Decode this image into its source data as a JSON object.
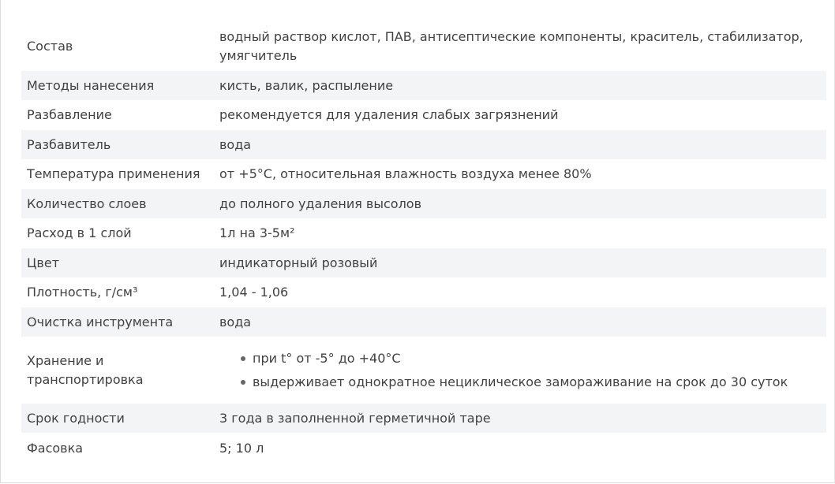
{
  "rows": [
    {
      "label": "Состав",
      "value": "водный раствор кислот, ПАВ, антисептические компоненты, краситель, стабилизатор, умягчитель"
    },
    {
      "label": "Методы нанесения",
      "value": "кисть, валик, распыление"
    },
    {
      "label": "Разбавление",
      "value": "рекомендуется для удаления слабых загрязнений"
    },
    {
      "label": "Разбавитель",
      "value": "вода"
    },
    {
      "label": "Температура применения",
      "value": "от +5°С, относительная влажность воздуха менее 80%"
    },
    {
      "label": "Количество слоев",
      "value": "до полного удаления высолов"
    },
    {
      "label": "Расход в 1 слой",
      "value": "1л на 3-5м²"
    },
    {
      "label": "Цвет",
      "value": "индикаторный розовый"
    },
    {
      "label": "Плотность, г/см³",
      "value": "1,04 - 1,06"
    },
    {
      "label": "Очистка инструмента",
      "value": "вода"
    },
    {
      "label": "Хранение и транспортировка",
      "items": [
        "при t° от -5° до +40°С",
        "выдерживает однократное нециклическое замораживание на срок до 30 суток"
      ]
    },
    {
      "label": "Срок годности",
      "value": "3 года в заполненной герметичной таре"
    },
    {
      "label": "Фасовка",
      "value": "5; 10 л"
    }
  ]
}
